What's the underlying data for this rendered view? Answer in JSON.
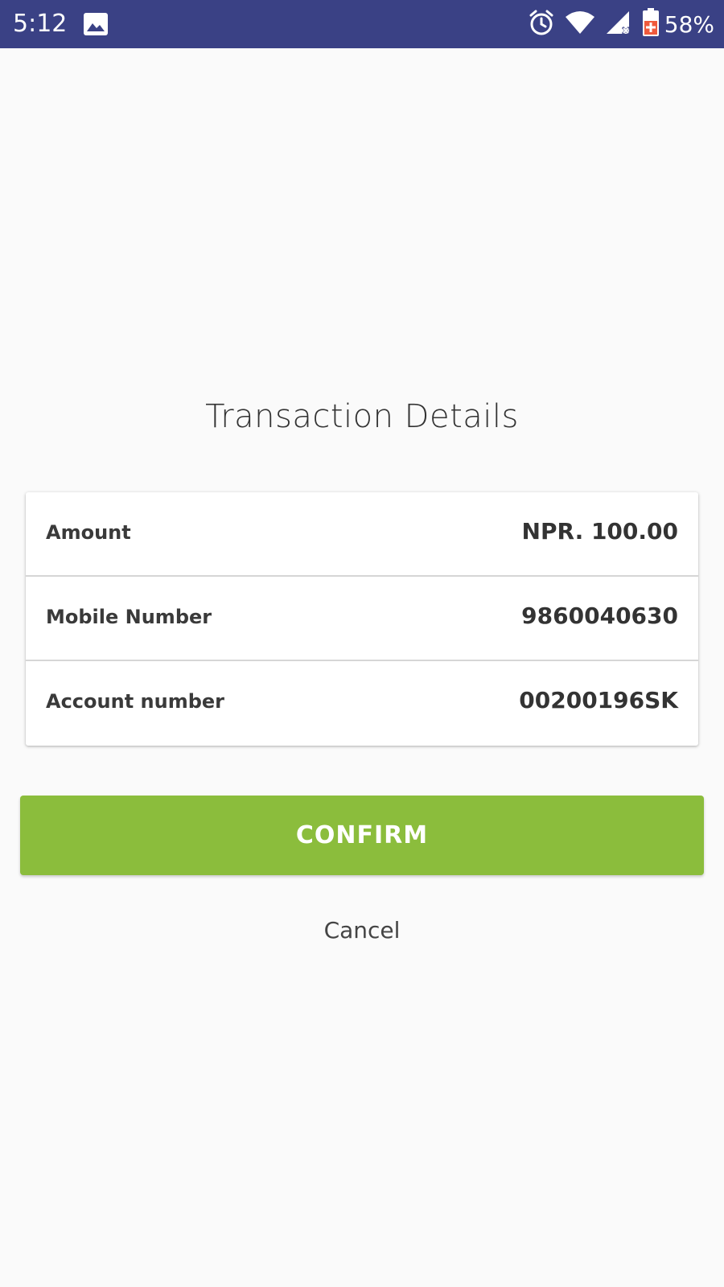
{
  "status_bar": {
    "time": "5:12",
    "battery_percent": "58%",
    "icons": [
      "gallery-icon",
      "alarm-icon",
      "wifi-icon",
      "signal-icon",
      "battery-icon"
    ],
    "background_color": "#3a4185"
  },
  "page": {
    "title": "Transaction Details"
  },
  "details": {
    "rows": [
      {
        "label": "Amount",
        "value": "NPR. 100.00"
      },
      {
        "label": "Mobile Number",
        "value": "9860040630"
      },
      {
        "label": "Account number",
        "value": "00200196SK"
      }
    ]
  },
  "actions": {
    "confirm_label": "CONFIRM",
    "confirm_color": "#8bbd3c",
    "cancel_label": "Cancel"
  }
}
